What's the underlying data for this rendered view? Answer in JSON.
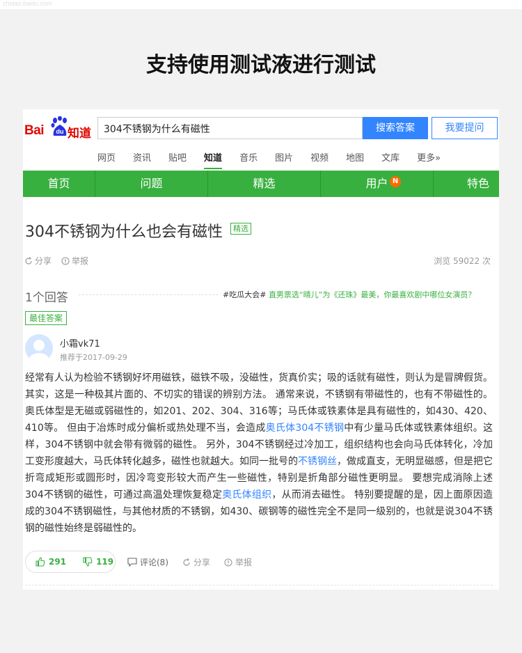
{
  "watermark": "zhidao.baidu.com",
  "banner_title": "支持使用测试液进行测试",
  "header": {
    "logo_bai": "Bai",
    "logo_du": "du",
    "logo_zhidao": "知道",
    "search_value": "304不锈钢为什么有磁性",
    "search_button": "搜索答案",
    "ask_button": "我要提问"
  },
  "nav": [
    "网页",
    "资讯",
    "贴吧",
    "知道",
    "音乐",
    "图片",
    "视频",
    "地图",
    "文库",
    "更多»"
  ],
  "nav_active": "知道",
  "green_bar": [
    "首页",
    "问题",
    "精选",
    "用户",
    "特色"
  ],
  "user_badge": "N",
  "question": {
    "title": "304不锈钢为什么也会有磁性",
    "tag": "精选",
    "share": "分享",
    "report": "举报",
    "views": "浏览 59022 次"
  },
  "answers": {
    "count_label": "1个回答",
    "promo_prefix": "#吃瓜大会#",
    "promo_text": "直男票选“晴儿”为《还珠》最美，你最喜欢剧中哪位女演员？",
    "best_label": "最佳答案"
  },
  "answer": {
    "user": "小霜vk71",
    "date": "推荐于2017-09-29",
    "seg1": "经常有人认为检验不锈钢好坏用磁铁，磁铁不吸，没磁性，货真价实；吸的话就有磁性，则认为是冒牌假货。其实，这是一种极其片面的、不切实的错误的辨别方法。 通常来说，不锈钢有带磁性的，也有不带磁性的。奥氏体型是无磁或弱磁性的，如201、202、304、316等；马氏体或铁素体是具有磁性的，如430、420、410等。 但由于冶炼时成分偏析或热处理不当，会造成",
    "link1": "奥氏体304不锈钢",
    "seg2": "中有少量马氏体或铁素体组织。这样，304不锈钢中就会带有微弱的磁性。 另外，304不锈钢经过冷加工，组织结构也会向马氏体转化，冷加工变形度越大，马氏体转化越多，磁性也就越大。如同一批号的",
    "link2": "不锈钢丝",
    "seg3": "，做成直支，无明显磁感，但是把它折弯成矩形或圆形时，因冷弯变形较大而产生一些磁性，特别是折角部分磁性更明显。 要想完成消除上述304不锈钢的磁性，可通过高温处理恢复稳定",
    "link3": "奥氏体组织",
    "seg4": "，从而消去磁性。 特别要提醒的是，因上面原因造成的304不锈钢磁性，与其他材质的不锈钢，如430、碳钢等的磁性完全不是同一级别的，也就是说304不锈钢的磁性始终是弱磁性的。",
    "likes": "291",
    "dislikes": "119",
    "comments": "评论(8)",
    "share": "分享",
    "report": "举报"
  }
}
